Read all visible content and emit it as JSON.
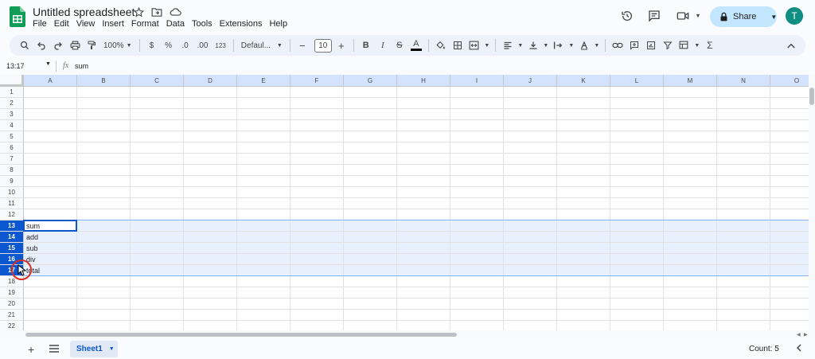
{
  "header": {
    "title": "Untitled spreadsheet",
    "menu": [
      "File",
      "Edit",
      "View",
      "Insert",
      "Format",
      "Data",
      "Tools",
      "Extensions",
      "Help"
    ],
    "share_label": "Share",
    "avatar_letter": "T"
  },
  "toolbar": {
    "zoom": "100%",
    "currency": "$",
    "percent": "%",
    "decrease_decimal": ".0",
    "increase_decimal": ".00",
    "number_format": "123",
    "font": "Defaul...",
    "font_size": "10",
    "bold": "B",
    "italic": "I",
    "strike": "S",
    "text_color": "A",
    "functions": "Σ"
  },
  "formula_bar": {
    "name_box": "13:17",
    "fx": "fx",
    "value": "sum"
  },
  "grid": {
    "columns": [
      "A",
      "B",
      "C",
      "D",
      "E",
      "F",
      "G",
      "H",
      "I",
      "J",
      "K",
      "L",
      "M",
      "N",
      "O"
    ],
    "rows": [
      "1",
      "2",
      "3",
      "4",
      "5",
      "6",
      "7",
      "8",
      "9",
      "10",
      "11",
      "12",
      "13",
      "14",
      "15",
      "16",
      "17",
      "18",
      "19",
      "20",
      "21",
      "22"
    ],
    "selected_rows": [
      "13",
      "14",
      "15",
      "16",
      "17"
    ],
    "cells": [
      {
        "row": "13",
        "col": "A",
        "value": "sum"
      },
      {
        "row": "14",
        "col": "A",
        "value": "add"
      },
      {
        "row": "15",
        "col": "A",
        "value": "sub"
      },
      {
        "row": "16",
        "col": "A",
        "value": "div"
      },
      {
        "row": "17",
        "col": "A",
        "value": "total"
      }
    ],
    "active_cell": "A13"
  },
  "bottom": {
    "sheet_name": "Sheet1",
    "status": "Count: 5"
  },
  "colors": {
    "accent": "#0b57d0",
    "selection": "#e8f0fe",
    "share_bg": "#c2e7ff",
    "logo": "#0f9d58"
  }
}
